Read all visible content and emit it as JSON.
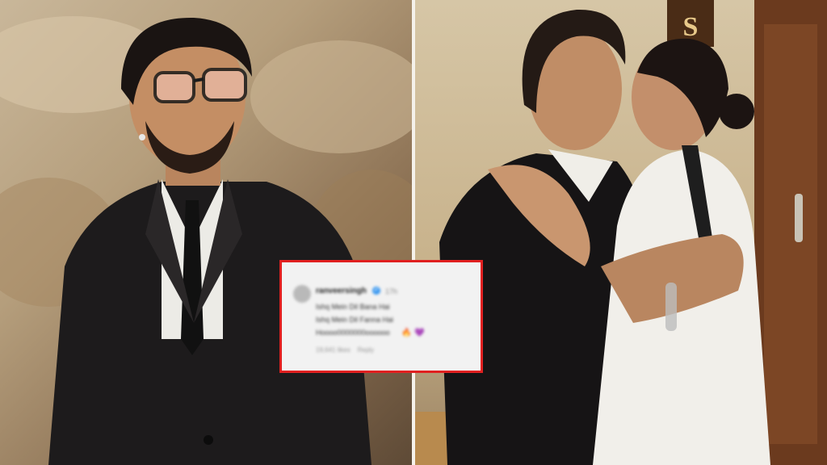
{
  "comment": {
    "username": "ranveersingh",
    "verified_mark": "✔",
    "time": "17h",
    "line1": "Ishq Mein Dil Bana Hai",
    "line2": "Ishq Mein Dil Fanna Hai",
    "line3": "Hoooo0000000oooooo",
    "emoji1": "🔥",
    "emoji2": "💜",
    "likes": "19,641 likes",
    "reply": "Reply"
  },
  "door_sign": "S",
  "colors": {
    "highlight_border": "#e02020",
    "verified": "#3897f0"
  }
}
